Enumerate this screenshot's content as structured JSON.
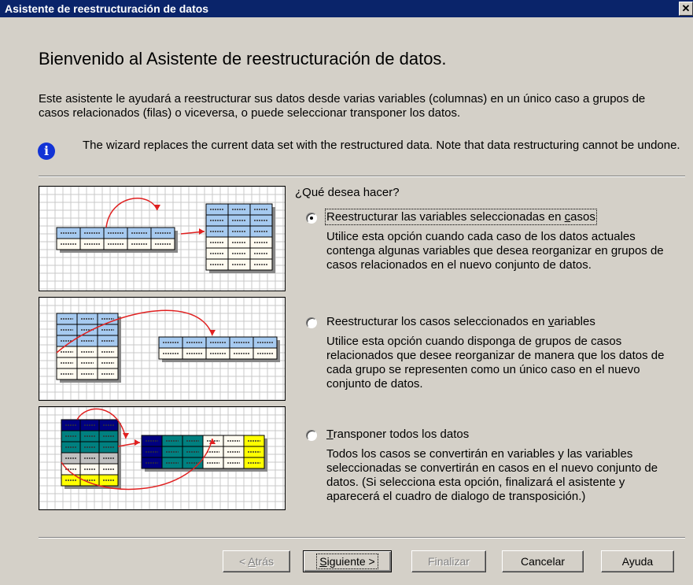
{
  "window": {
    "title": "Asistente de reestructuración de datos",
    "close_glyph": "✕"
  },
  "heading": "Bienvenido al Asistente de reestructuración de datos.",
  "intro": "Este asistente le ayudará a reestructurar sus datos desde varias variables (columnas) en un único caso a grupos de casos relacionados (filas) o viceversa, o puede seleccionar transponer los datos.",
  "info": {
    "icon": "info-icon",
    "glyph": "i",
    "text": "The wizard replaces the current data set with the restructured data.  Note that data restructuring cannot be undone."
  },
  "question": "¿Qué desea hacer?",
  "options": [
    {
      "label_pre": "Reestructurar las variables seleccionadas en ",
      "label_key": "c",
      "label_post": "asos",
      "selected": true,
      "description": "Utilice esta opción cuando cada caso de los datos actuales contenga algunas variables que desea reorganizar en grupos de casos relacionados en el nuevo conjunto de datos."
    },
    {
      "label_pre": "Reestructurar los casos seleccionados en ",
      "label_key": "v",
      "label_post": "ariables",
      "selected": false,
      "description": "Utilice esta opción cuando disponga de grupos de casos relacionados que desee reorganizar de manera que los datos de cada grupo se representen como un único caso en el nuevo conjunto de datos."
    },
    {
      "label_pre": "",
      "label_key": "T",
      "label_post": "ransponer todos los datos",
      "selected": false,
      "description": "Todos los casos se convertirán en variables y las variables seleccionadas se convertirán en casos en el nuevo conjunto de datos. (Si selecciona esta opción, finalizará el asistente y aparecerá el cuadro de dialogo de transposición.)"
    }
  ],
  "buttons": {
    "back": {
      "pre": "< ",
      "key": "A",
      "post": "trás",
      "enabled": false
    },
    "next": {
      "pre": "",
      "key": "S",
      "post": "iguiente >",
      "enabled": true
    },
    "finish": {
      "label": "Finalizar",
      "enabled": false
    },
    "cancel": {
      "label": "Cancelar",
      "enabled": true
    },
    "help": {
      "label": "Ayuda",
      "enabled": true
    }
  },
  "colors": {
    "title_bar": "#0a246a",
    "dialog_bg": "#d4d0c8",
    "cell_blue": "#a6caf0",
    "cell_cream": "#fffbf0",
    "arrow_red": "#e02020",
    "cell_navy": "#000080",
    "cell_teal": "#008080",
    "cell_yellow": "#ffff00",
    "cell_gray": "#c0c0c0"
  }
}
